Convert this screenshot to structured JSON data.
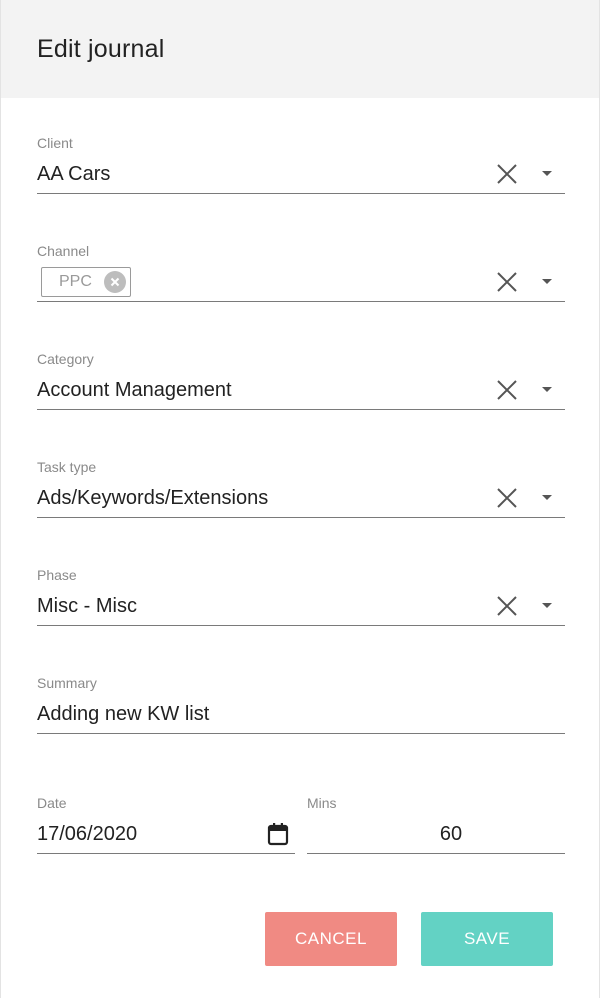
{
  "dialog": {
    "title": "Edit journal"
  },
  "fields": {
    "client": {
      "label": "Client",
      "value": "AA Cars"
    },
    "channel": {
      "label": "Channel",
      "chips": [
        "PPC"
      ]
    },
    "category": {
      "label": "Category",
      "value": "Account Management"
    },
    "task_type": {
      "label": "Task type",
      "value": "Ads/Keywords/Extensions"
    },
    "phase": {
      "label": "Phase",
      "value": "Misc - Misc"
    },
    "summary": {
      "label": "Summary",
      "value": "Adding new KW list"
    },
    "date": {
      "label": "Date",
      "value": "17/06/2020"
    },
    "mins": {
      "label": "Mins",
      "value": "60"
    }
  },
  "actions": {
    "cancel_label": "CANCEL",
    "save_label": "SAVE"
  },
  "icons": {
    "clear": "close-x-icon",
    "dropdown": "caret-down-icon",
    "chip_remove": "close-circle-icon",
    "calendar": "calendar-icon"
  },
  "colors": {
    "header_bg": "#f3f3f3",
    "cancel_bg": "#f08a83",
    "save_bg": "#63d2c4",
    "label": "#8a8a8a",
    "underline": "#7a7a7a"
  }
}
